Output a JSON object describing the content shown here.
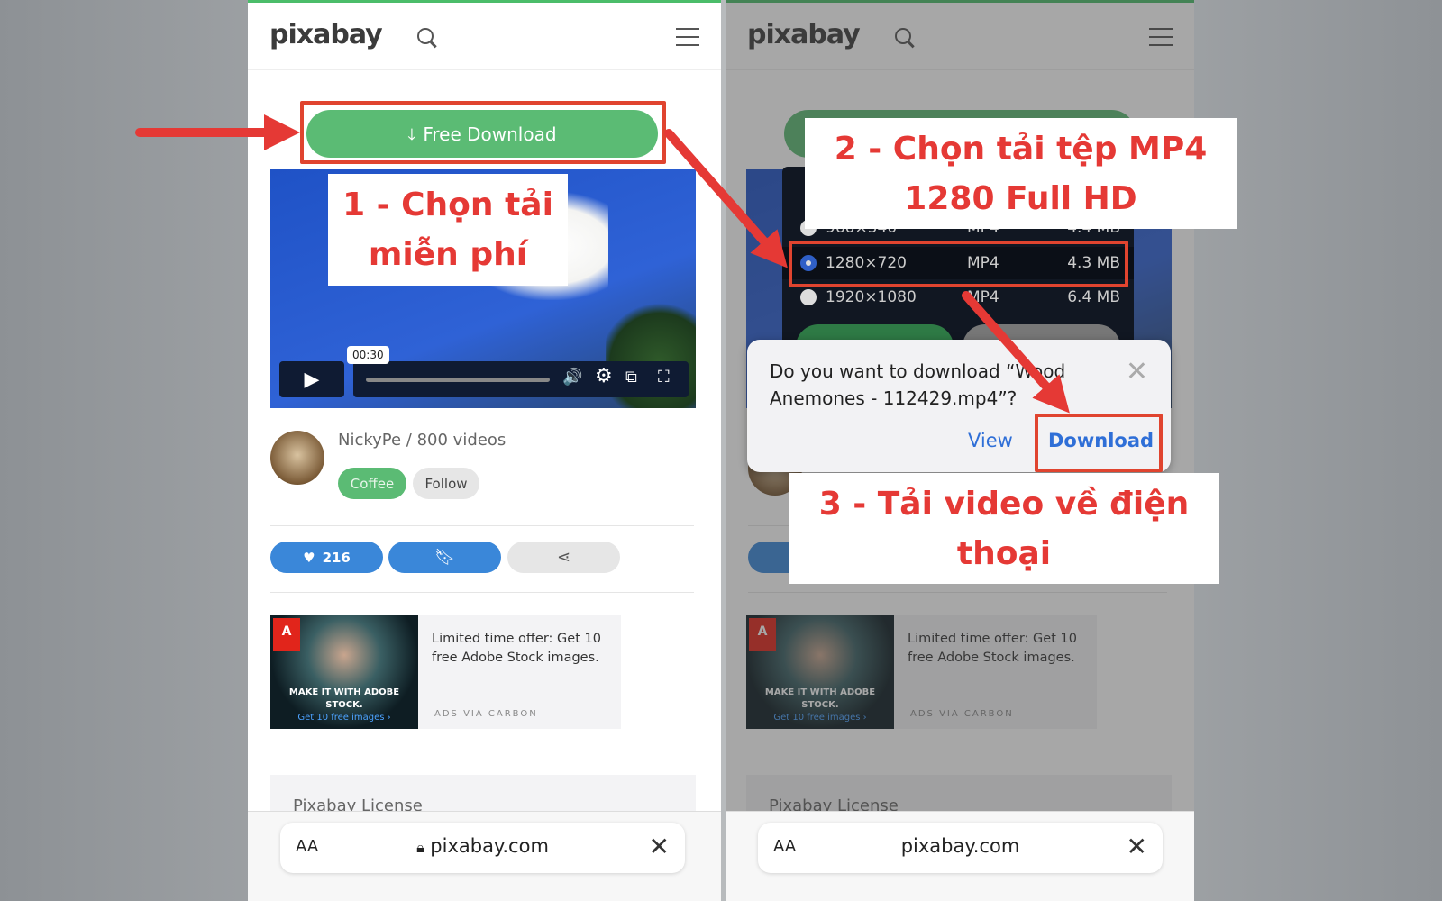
{
  "colors": {
    "brand_green": "#5bbb74",
    "accent_blue": "#2f6fd7",
    "annotation_red": "#e53935"
  },
  "left": {
    "logo": "pixabay",
    "download_button": "Free Download",
    "video": {
      "time_tooltip": "00:30"
    },
    "author": {
      "line": "NickyPe / 800 videos",
      "coffee": "Coffee",
      "follow": "Follow"
    },
    "actions": {
      "likes": "216"
    },
    "ad": {
      "text": "Limited time offer: Get 10 free Adobe Stock images.",
      "via": "ADS VIA CARBON",
      "caption": "MAKE IT WITH ADOBE STOCK.",
      "cta": "Get 10 free images ›",
      "logo": "Adobe"
    },
    "license": "Pixabay License",
    "browser": {
      "aa": "AA",
      "url": "pixabay.com"
    }
  },
  "right": {
    "logo": "pixabay",
    "resolutions": [
      {
        "size": "960×540",
        "format": "MP4",
        "filesize": "4.4 MB",
        "selected": false
      },
      {
        "size": "1280×720",
        "format": "MP4",
        "filesize": "4.3 MB",
        "selected": true
      },
      {
        "size": "1920×1080",
        "format": "MP4",
        "filesize": "6.4 MB",
        "selected": false
      }
    ],
    "dialog": {
      "message": "Do you want to download “Wood Anemones - 112429.mp4”?",
      "view": "View",
      "download": "Download"
    },
    "ad": {
      "text": "Limited time offer: Get 10 free Adobe Stock images.",
      "via": "ADS VIA CARBON",
      "caption": "MAKE IT WITH ADOBE STOCK.",
      "cta": "Get 10 free images ›",
      "logo": "Adobe"
    },
    "license": "Pixabay License",
    "browser": {
      "aa": "AA",
      "url": "pixabay.com"
    }
  },
  "annotations": {
    "step1": "1 - Chọn tải miễn phí",
    "step2": "2 - Chọn tải tệp MP4 1280 Full HD",
    "step3": "3 - Tải video về điện thoại"
  }
}
